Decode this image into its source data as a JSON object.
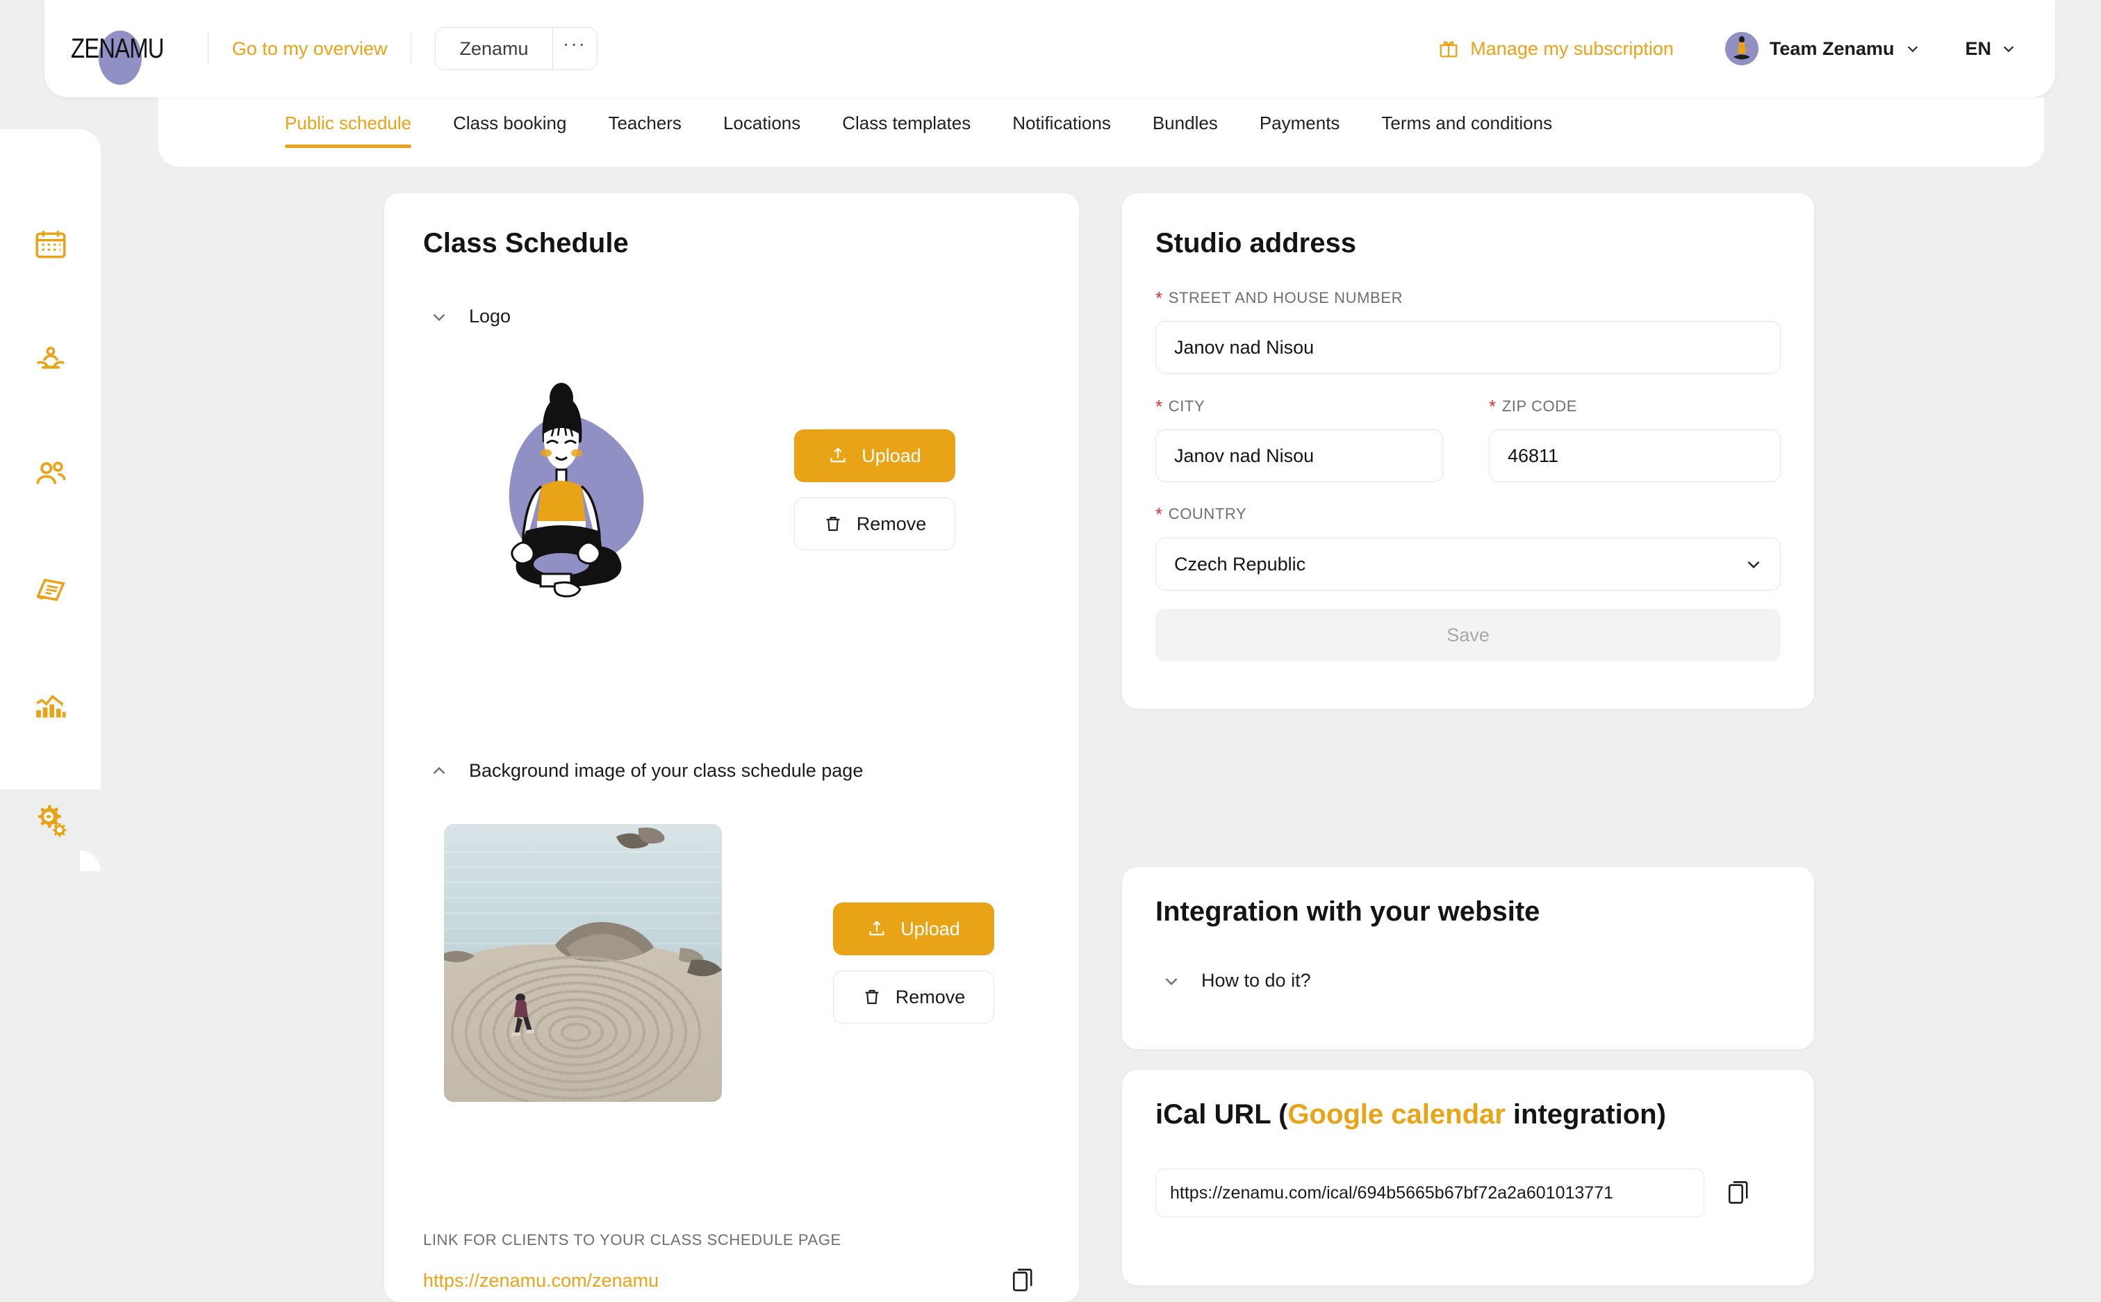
{
  "brand": {
    "logo_text": "ZENAMU"
  },
  "topbar": {
    "overview_link": "Go to my overview",
    "studio_name": "Zenamu",
    "studio_more": "···",
    "subscription_label": "Manage my subscription",
    "team_label": "Team Zenamu",
    "language": "EN"
  },
  "tabs": [
    {
      "label": "Public schedule",
      "active": true
    },
    {
      "label": "Class booking",
      "active": false
    },
    {
      "label": "Teachers",
      "active": false
    },
    {
      "label": "Locations",
      "active": false
    },
    {
      "label": "Class templates",
      "active": false
    },
    {
      "label": "Notifications",
      "active": false
    },
    {
      "label": "Bundles",
      "active": false
    },
    {
      "label": "Payments",
      "active": false
    },
    {
      "label": "Terms and conditions",
      "active": false
    }
  ],
  "sidebar": {
    "items": [
      {
        "icon": "calendar-icon",
        "active": false
      },
      {
        "icon": "yoga-person-icon",
        "active": false
      },
      {
        "icon": "people-icon",
        "active": false
      },
      {
        "icon": "invoice-icon",
        "active": false
      },
      {
        "icon": "analytics-chart-icon",
        "active": false
      },
      {
        "icon": "settings-gears-icon",
        "active": true
      }
    ]
  },
  "class_schedule": {
    "title": "Class Schedule",
    "logo_section": {
      "label": "Logo",
      "expanded": true,
      "chevron": "chevron-down-icon",
      "upload_label": "Upload",
      "remove_label": "Remove"
    },
    "background_section": {
      "label": "Background image of your class schedule page",
      "expanded": true,
      "chevron": "chevron-up-icon",
      "upload_label": "Upload",
      "remove_label": "Remove"
    },
    "link_label": "LINK FOR CLIENTS TO YOUR CLASS SCHEDULE PAGE",
    "link_url": "https://zenamu.com/zenamu",
    "copy_icon": "copy-icon"
  },
  "studio_address": {
    "title": "Studio address",
    "street_label": "STREET AND HOUSE NUMBER",
    "street_value": "Janov nad Nisou",
    "city_label": "CITY",
    "city_value": "Janov nad Nisou",
    "zip_label": "ZIP CODE",
    "zip_value": "46811",
    "country_label": "COUNTRY",
    "country_value": "Czech Republic",
    "required_marker": "*",
    "save_label": "Save"
  },
  "integration": {
    "title": "Integration with your website",
    "how_label": "How to do it?",
    "chevron": "chevron-down-icon"
  },
  "ical": {
    "title_prefix": "iCal URL (",
    "title_link": "Google calendar",
    "title_suffix": " integration)",
    "url_value": "https://zenamu.com/ical/694b5665b67bf72a2a601013771",
    "copy_icon": "copy-icon"
  },
  "colors": {
    "accent": "#e8a317",
    "page_bg": "#efefef",
    "card_bg": "#ffffff",
    "required": "#e03131",
    "avatar_purple": "#9190c4"
  }
}
